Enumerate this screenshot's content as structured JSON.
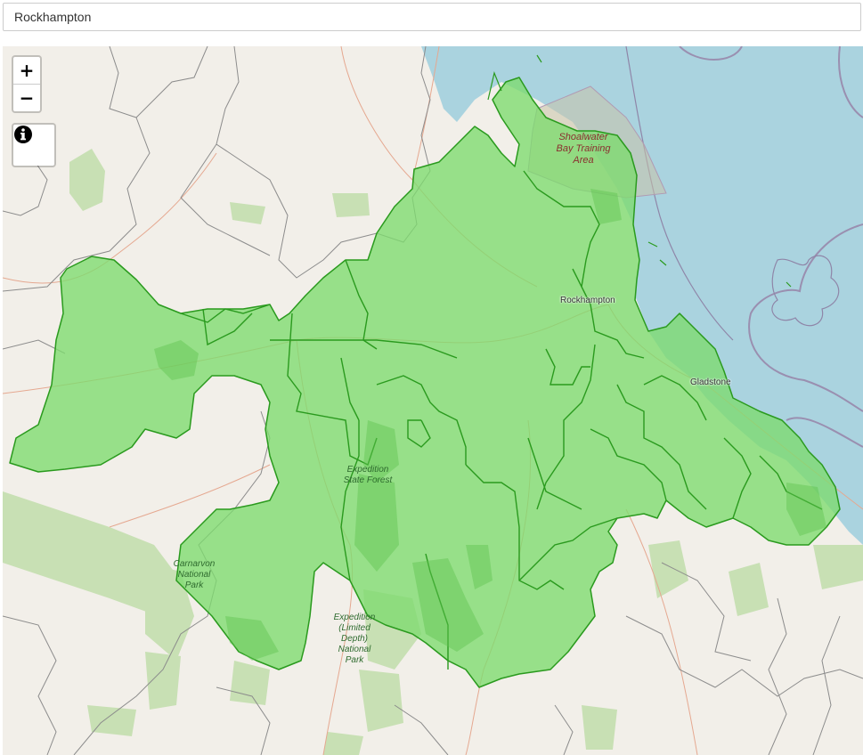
{
  "search": {
    "value": "Rockhampton"
  },
  "map_controls": {
    "zoom_in_label": "+",
    "zoom_out_label": "−",
    "info_icon": "info-circle-icon"
  },
  "map_labels": {
    "shoalwater": [
      "Shoalwater",
      "Bay Training",
      "Area"
    ],
    "rockhampton": "Rockhampton",
    "gladstone": "Gladstone",
    "expedition_state_forest": [
      "Expedition",
      "State Forest"
    ],
    "carnarvon": [
      "Carnarvon",
      "National",
      "Park"
    ],
    "expedition_limited": [
      "Expedition",
      "(Limited",
      "Depth)",
      "National",
      "Park"
    ]
  },
  "colors": {
    "land": "#f2efe9",
    "water": "#aad3df",
    "region_fill": "#7edb6e",
    "region_stroke": "#2a9a1e",
    "park": "#c8e0b4"
  }
}
